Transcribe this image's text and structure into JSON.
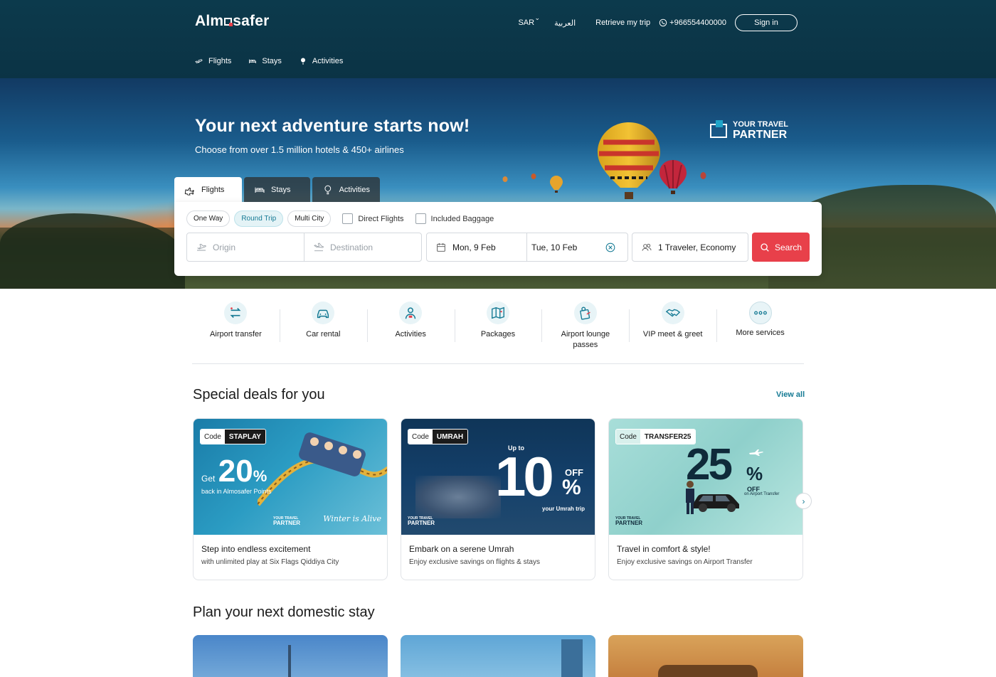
{
  "brand": {
    "name_left": "Alm",
    "name_right": "safer",
    "accent": "#e8404a",
    "teal": "#157a94"
  },
  "header": {
    "currency": "SAR",
    "language": "العربية",
    "retrieve": "Retrieve my trip",
    "phone": "+966554400000",
    "signin": "Sign in",
    "subnav": [
      {
        "label": "Flights",
        "icon": "plane-icon"
      },
      {
        "label": "Stays",
        "icon": "bed-icon"
      },
      {
        "label": "Activities",
        "icon": "balloon-icon"
      }
    ]
  },
  "hero": {
    "title": "Your next adventure starts now!",
    "subtitle": "Choose from over 1.5 million hotels & 450+ airlines",
    "partner_line1": "YOUR TRAVEL",
    "partner_line2": "PARTNER"
  },
  "search": {
    "tabs": [
      {
        "label": "Flights",
        "active": true
      },
      {
        "label": "Stays",
        "active": false
      },
      {
        "label": "Activities",
        "active": false
      }
    ],
    "trip_types": [
      "One Way",
      "Round Trip",
      "Multi City"
    ],
    "selected_trip_type": "Round Trip",
    "direct_flights": "Direct Flights",
    "included_baggage": "Included Baggage",
    "origin_placeholder": "Origin",
    "destination_placeholder": "Destination",
    "depart": "Mon, 9 Feb",
    "return": "Tue, 10 Feb",
    "travelers": "1 Traveler, Economy",
    "search_button": "Search"
  },
  "services": [
    {
      "label": "Airport transfer",
      "icon": "transfer-icon"
    },
    {
      "label": "Car rental",
      "icon": "car-icon"
    },
    {
      "label": "Activities",
      "icon": "guide-icon"
    },
    {
      "label": "Packages",
      "icon": "map-icon"
    },
    {
      "label": "Airport lounge passes",
      "icon": "lounge-icon"
    },
    {
      "label": "VIP meet & greet",
      "icon": "handshake-icon"
    },
    {
      "label": "More services",
      "icon": "more-icon"
    }
  ],
  "deals": {
    "title": "Special deals for you",
    "view_all": "View all",
    "cards": [
      {
        "code_label": "Code",
        "code": "STAPLAY",
        "promo_prefix": "Get",
        "promo_big": "20",
        "promo_pct": "%",
        "promo_line": "back in Almosafer Points",
        "brand_tag": "Winter is Alive",
        "title": "Step into endless excitement",
        "desc": "with unlimited play at Six Flags Qiddiya City"
      },
      {
        "code_label": "Code",
        "code": "UMRAH",
        "promo_prefix": "Up to",
        "promo_big": "10",
        "promo_pct": "%",
        "promo_off": "OFF",
        "promo_line": "your Umrah trip",
        "title": "Embark on a serene Umrah",
        "desc": "Enjoy exclusive savings on flights & stays"
      },
      {
        "code_label": "Code",
        "code": "TRANSFER25",
        "promo_big": "25",
        "promo_pct": "%",
        "promo_off": "OFF",
        "promo_line": "on Airport Transfer",
        "title": "Travel in comfort & style!",
        "desc": "Enjoy exclusive savings on Airport Transfer"
      }
    ],
    "partner_small1": "YOUR TRAVEL",
    "partner_small2": "PARTNER"
  },
  "domestic": {
    "title": "Plan your next domestic stay"
  }
}
